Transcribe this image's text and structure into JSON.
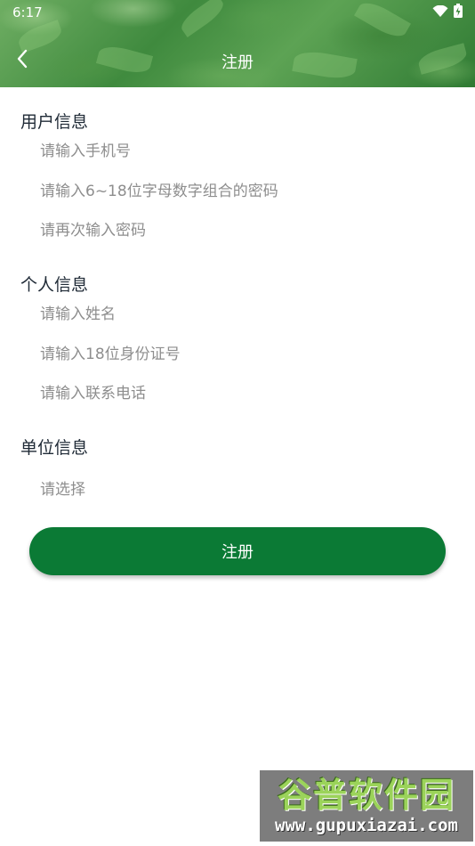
{
  "status_bar": {
    "time": "6:17"
  },
  "header": {
    "title": "注册",
    "back_icon": "chevron-left-icon"
  },
  "sections": {
    "user": {
      "title": "用户信息",
      "phone_placeholder": "请输入手机号",
      "password_placeholder": "请输入6~18位字母数字组合的密码",
      "confirm_placeholder": "请再次输入密码"
    },
    "personal": {
      "title": "个人信息",
      "name_placeholder": "请输入姓名",
      "id_placeholder": "请输入18位身份证号",
      "contact_placeholder": "请输入联系电话"
    },
    "unit": {
      "title": "单位信息",
      "select_placeholder": "请选择"
    }
  },
  "submit_label": "注册",
  "watermark": {
    "title": "谷普软件园",
    "url": "www.gupuxiazai.com"
  },
  "colors": {
    "primary": "#0b7a35",
    "section_title": "#1f2a36",
    "placeholder": "#8e8e8e"
  }
}
